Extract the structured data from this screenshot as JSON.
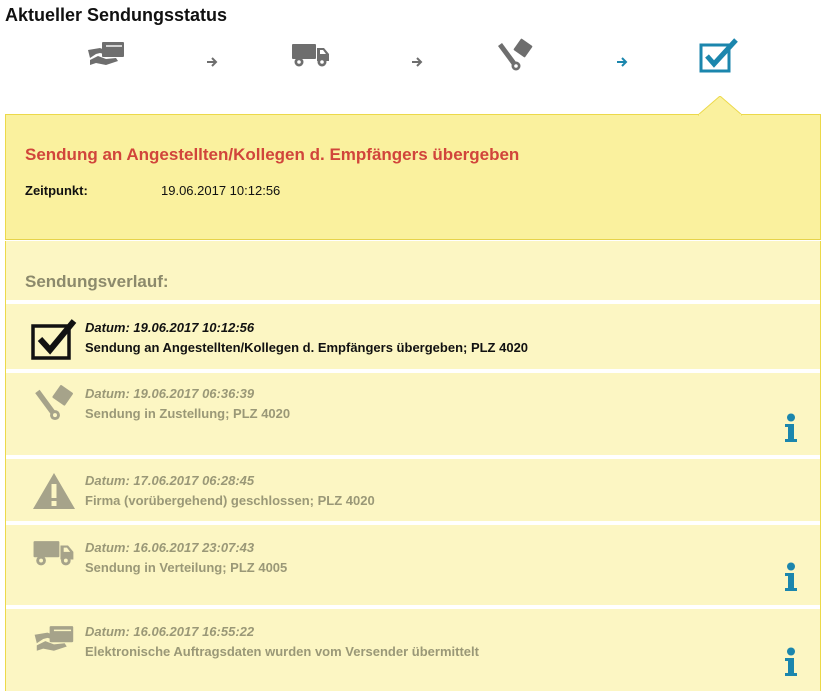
{
  "header": {
    "title": "Aktueller Sendungsstatus"
  },
  "progress": {
    "steps": [
      {
        "icon": "handover-icon",
        "state": "done"
      },
      {
        "icon": "truck-icon",
        "state": "done"
      },
      {
        "icon": "hand-truck-icon",
        "state": "done"
      },
      {
        "icon": "checkbox-checked-icon",
        "state": "current"
      }
    ],
    "colors": {
      "done": "#6e6e6e",
      "current": "#1b86ad"
    }
  },
  "current_status": {
    "title": "Sendung an Angestellten/Kollegen d. Empfängers übergeben",
    "time_label": "Zeitpunkt:",
    "time_value": "19.06.2017 10:12:56"
  },
  "history": {
    "heading": "Sendungsverlauf:",
    "entries": [
      {
        "icon": "checkbox-checked-icon",
        "date": "Datum: 19.06.2017 10:12:56",
        "description": "Sendung an Angestellten/Kollegen d. Empfängers übergeben; PLZ 4020",
        "has_info": false,
        "current": true
      },
      {
        "icon": "hand-truck-icon",
        "date": "Datum: 19.06.2017 06:36:39",
        "description": "Sendung in Zustellung; PLZ 4020",
        "has_info": true,
        "current": false
      },
      {
        "icon": "warning-icon",
        "date": "Datum: 17.06.2017 06:28:45",
        "description": "Firma (vorübergehend) geschlossen; PLZ 4020",
        "has_info": false,
        "current": false
      },
      {
        "icon": "truck-icon",
        "date": "Datum: 16.06.2017 23:07:43",
        "description": "Sendung in Verteilung; PLZ 4005",
        "has_info": true,
        "current": false
      },
      {
        "icon": "handover-icon",
        "date": "Datum: 16.06.2017 16:55:22",
        "description": "Elektronische Auftragsdaten wurden vom Versender übermittelt",
        "has_info": true,
        "current": false
      }
    ]
  },
  "colors": {
    "status_red": "#d1453b",
    "panel_yellow": "#faf19e",
    "history_yellow": "#fcf6c3",
    "muted_text": "#9a9877",
    "info_blue": "#1b86ad"
  }
}
